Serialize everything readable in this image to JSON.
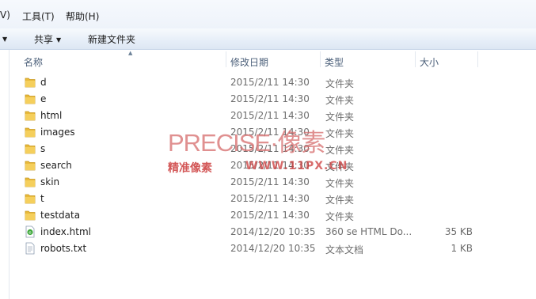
{
  "menu": {
    "items": [
      "V)",
      "工具(T)",
      "帮助(H)"
    ]
  },
  "toolbar": {
    "share_label": "共享",
    "new_folder_label": "新建文件夹"
  },
  "columns": {
    "name": "名称",
    "date": "修改日期",
    "type": "类型",
    "size": "大小"
  },
  "files": [
    {
      "name": "d",
      "date": "2015/2/11 14:30",
      "type": "文件夹",
      "size": "",
      "kind": "folder"
    },
    {
      "name": "e",
      "date": "2015/2/11 14:30",
      "type": "文件夹",
      "size": "",
      "kind": "folder"
    },
    {
      "name": "html",
      "date": "2015/2/11 14:30",
      "type": "文件夹",
      "size": "",
      "kind": "folder"
    },
    {
      "name": "images",
      "date": "2015/2/11 14:30",
      "type": "文件夹",
      "size": "",
      "kind": "folder"
    },
    {
      "name": "s",
      "date": "2015/2/11 14:30",
      "type": "文件夹",
      "size": "",
      "kind": "folder"
    },
    {
      "name": "search",
      "date": "2015/2/11 14:30",
      "type": "文件夹",
      "size": "",
      "kind": "folder"
    },
    {
      "name": "skin",
      "date": "2015/2/11 14:30",
      "type": "文件夹",
      "size": "",
      "kind": "folder"
    },
    {
      "name": "t",
      "date": "2015/2/11 14:30",
      "type": "文件夹",
      "size": "",
      "kind": "folder"
    },
    {
      "name": "testdata",
      "date": "2015/2/11 14:30",
      "type": "文件夹",
      "size": "",
      "kind": "folder"
    },
    {
      "name": "index.html",
      "date": "2014/12/20 10:35",
      "type": "360 se HTML Do...",
      "size": "35 KB",
      "kind": "html"
    },
    {
      "name": "robots.txt",
      "date": "2014/12/20 10:35",
      "type": "文本文档",
      "size": "1 KB",
      "kind": "text"
    }
  ],
  "watermark": {
    "title": "PRECISE·像素",
    "slogan": "精准像素",
    "site": "WWW.11PX.CN"
  },
  "colors": {
    "folder": "#e8b93a",
    "watermark": "#cc3b3b",
    "header_text": "#4c607a"
  }
}
